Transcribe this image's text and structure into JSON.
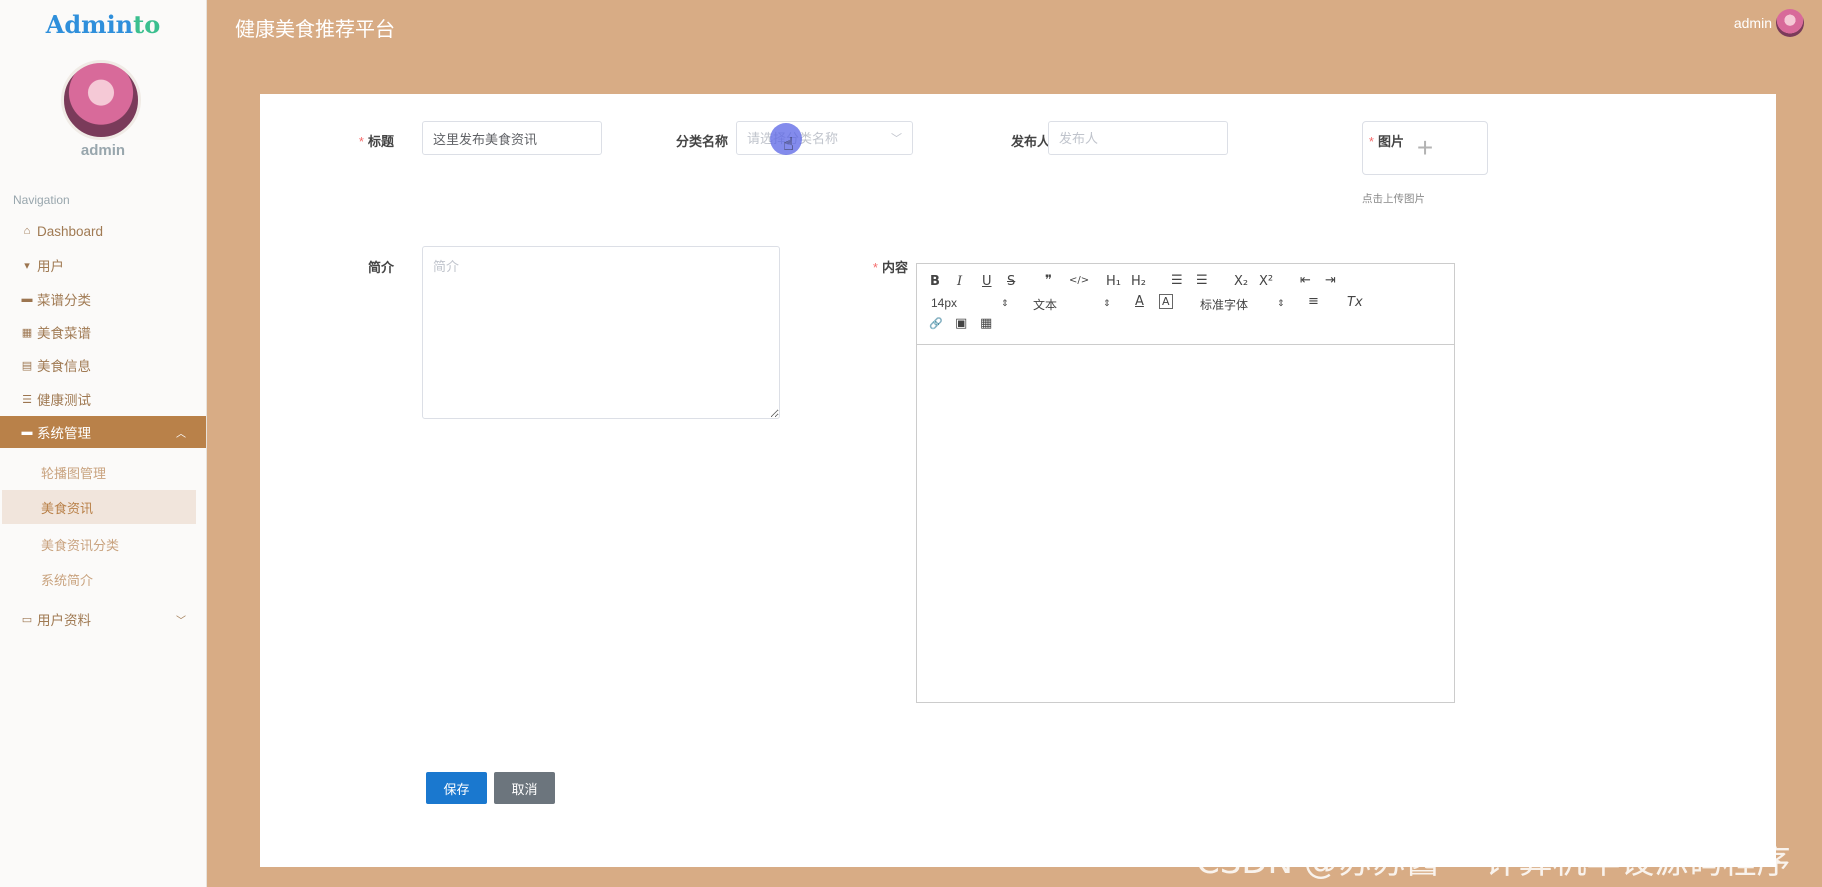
{
  "app": {
    "logo_part1": "Admin",
    "logo_part2": "to",
    "user_name": "admin",
    "page_title": "健康美食推荐平台",
    "top_user": "admin"
  },
  "sidebar": {
    "nav_title": "Navigation",
    "items": [
      {
        "label": "Dashboard",
        "icon": "home-icon"
      },
      {
        "label": "用户",
        "icon": "user-icon"
      },
      {
        "label": "菜谱分类",
        "icon": "briefcase-icon"
      },
      {
        "label": "美食菜谱",
        "icon": "grid-icon"
      },
      {
        "label": "美食信息",
        "icon": "clipboard-icon"
      },
      {
        "label": "健康测试",
        "icon": "list-icon"
      },
      {
        "label": "系统管理",
        "icon": "comment-icon"
      },
      {
        "label": "用户资料",
        "icon": "card-icon"
      }
    ],
    "sub_items": [
      "轮播图管理",
      "美食资讯",
      "美食资讯分类",
      "系统简介"
    ]
  },
  "form": {
    "title_label": "标题",
    "title_value": "这里发布美食资讯",
    "category_label": "分类名称",
    "category_placeholder": "请选择分类名称",
    "publisher_label": "发布人",
    "publisher_placeholder": "发布人",
    "image_label": "图片",
    "upload_hint": "点击上传图片",
    "intro_label": "简介",
    "intro_placeholder": "简介",
    "content_label": "内容",
    "required_mark": "*"
  },
  "editor": {
    "bold": "B",
    "italic": "I",
    "underline": "U",
    "strike": "S",
    "quote": "❞",
    "code": "</>",
    "h1": "H₁",
    "h2": "H₂",
    "ol": "☰",
    "ul": "☰",
    "sub": "X₂",
    "sup": "X²",
    "outdent": "⇤",
    "indent": "⇥",
    "size": "14px",
    "header": "文本",
    "font": "标准字体",
    "color": "A",
    "background": "A",
    "align": "≡",
    "clean": "Tx",
    "link": "🔗",
    "image": "▣",
    "video": "▦"
  },
  "buttons": {
    "save": "保存",
    "cancel": "取消"
  },
  "watermark": "CSDN @苏苏酱   ゛计算机毕设源码程序"
}
